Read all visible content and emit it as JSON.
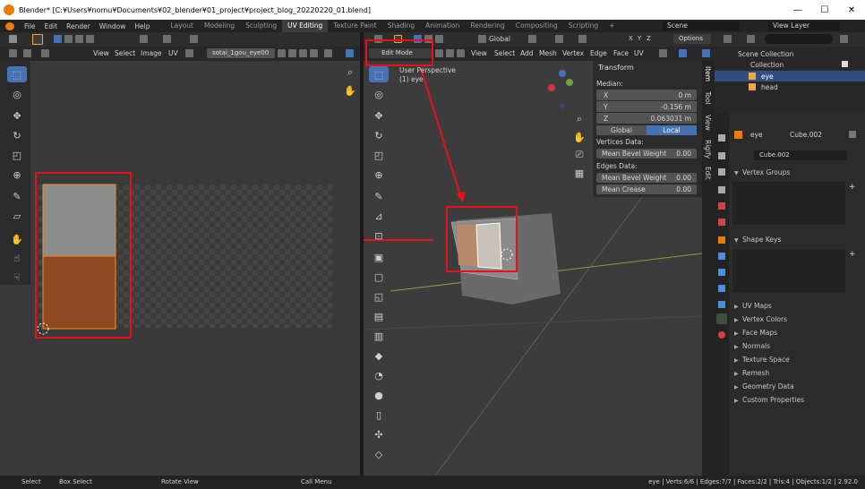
{
  "window": {
    "title": "Blender* [C:¥Users¥nomu¥Documents¥02_blender¥01_project¥project_blog_20220220_01.blend]",
    "minimize": "—",
    "maximize": "☐",
    "close": "✕"
  },
  "topbar": {
    "menus": [
      "File",
      "Edit",
      "Render",
      "Window",
      "Help"
    ],
    "workspaces": [
      "Layout",
      "Modeling",
      "Sculpting",
      "UV Editing",
      "Texture Paint",
      "Shading",
      "Animation",
      "Rendering",
      "Compositing",
      "Scripting"
    ],
    "active_workspace": "UV Editing",
    "add": "+",
    "scene": "Scene",
    "view_layer": "View Layer"
  },
  "uv_editor": {
    "menus": [
      "View",
      "Select",
      "Image",
      "UV"
    ],
    "image_name": "sotai_1gou_eye00"
  },
  "viewport": {
    "mode": "Edit Mode",
    "menus": [
      "View",
      "Select",
      "Add",
      "Mesh",
      "Vertex",
      "Edge",
      "Face",
      "UV"
    ],
    "orientation": "Global",
    "options": "Options",
    "overlay_line1": "User Perspective",
    "overlay_line2": "(1) eye",
    "axes": {
      "x": "X",
      "y": "Y",
      "z": "Z"
    },
    "side_tabs": [
      "Item",
      "Tool",
      "View",
      "Rigify",
      "Edit"
    ]
  },
  "transform": {
    "title": "Transform",
    "median": "Median:",
    "x_label": "X",
    "x_value": "0 m",
    "y_label": "Y",
    "y_value": "-0.156 m",
    "z_label": "Z",
    "z_value": "0.063031 m",
    "global": "Global",
    "local": "Local",
    "vertices_data": "Vertices Data:",
    "mean_bevel_weight_label": "Mean Bevel Weight",
    "mean_bevel_weight_v": "0.00",
    "edges_data": "Edges Data:",
    "mean_bevel_weight_e": "0.00",
    "mean_crease_label": "Mean Crease",
    "mean_crease": "0.00"
  },
  "outliner": {
    "scene_collection": "Scene Collection",
    "collection": "Collection",
    "items": [
      "eye",
      "head"
    ]
  },
  "properties": {
    "object": "eye",
    "mesh_data": "Cube.002",
    "mesh_field": "Cube.002",
    "sections_open": [
      "Vertex Groups",
      "Shape Keys"
    ],
    "sections": [
      "UV Maps",
      "Vertex Colors",
      "Face Maps",
      "Normals",
      "Texture Space",
      "Remesh",
      "Geometry Data",
      "Custom Properties"
    ]
  },
  "status": {
    "select": "Select",
    "box_select": "Box Select",
    "rotate_view": "Rotate View",
    "call_menu": "Call Menu",
    "stats": "eye | Verts:6/6 | Edges:7/7 | Faces:2/2 | Tris:4 | Objects:1/2 | 2.92.0"
  },
  "colors": {
    "accent": "#4772b3",
    "annotation": "#e8111a",
    "uv_face_top": "#8c8c8c",
    "uv_face_bottom": "#8b4a22",
    "selection": "#ff8b1f",
    "bg": "#303030"
  }
}
